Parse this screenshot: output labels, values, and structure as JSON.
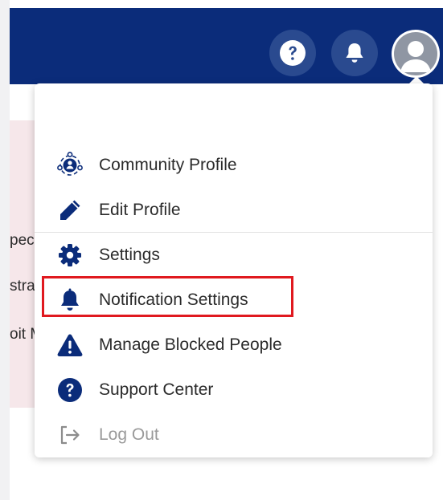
{
  "colors": {
    "topbar": "#0b2c7a",
    "icon_navy": "#0b2c7a",
    "highlight": "#e0191f",
    "muted": "#9a9a9a"
  },
  "header": {
    "icons": [
      "question-circle-icon",
      "bell-icon",
      "user-avatar-icon"
    ]
  },
  "background": {
    "partial_lines": [
      "pec",
      "stra",
      "oit M"
    ]
  },
  "menu": {
    "items": [
      {
        "label": "Community Profile",
        "icon": "community-profile-icon"
      },
      {
        "label": "Edit Profile",
        "icon": "pencil-icon"
      },
      {
        "label": "Settings",
        "icon": "gear-icon"
      },
      {
        "label": "Notification Settings",
        "icon": "bell-icon"
      },
      {
        "label": "Manage Blocked People",
        "icon": "warning-triangle-icon"
      },
      {
        "label": "Support Center",
        "icon": "question-circle-icon"
      },
      {
        "label": "Log Out",
        "icon": "logout-icon"
      }
    ],
    "highlighted": "Notification Settings"
  }
}
